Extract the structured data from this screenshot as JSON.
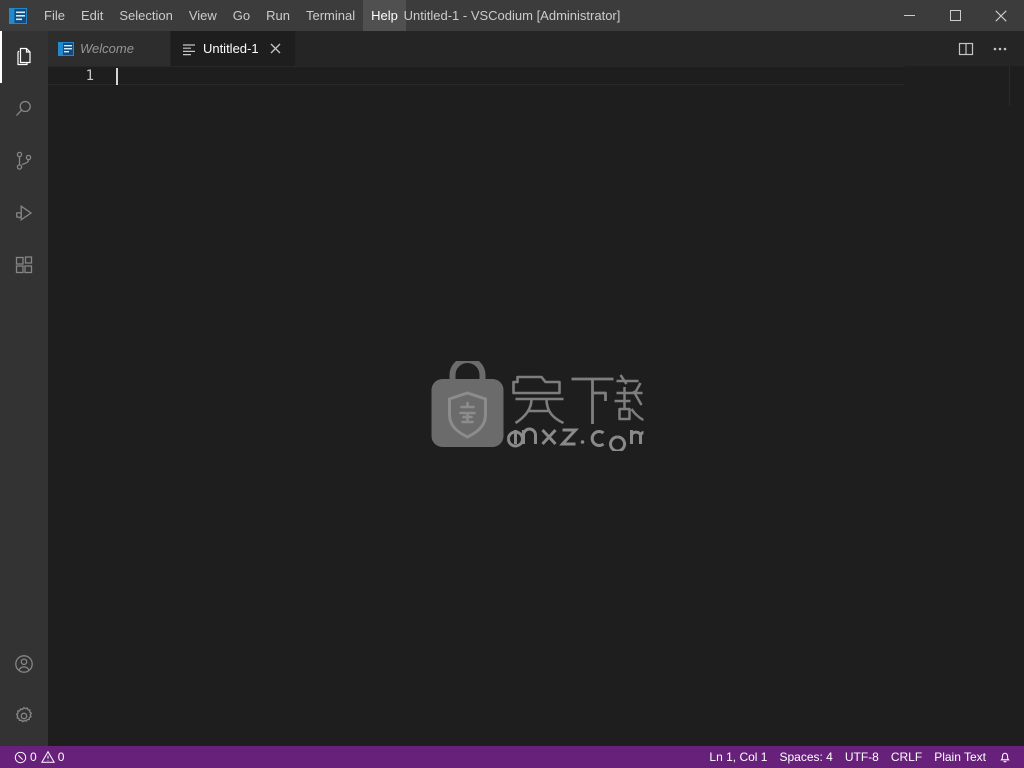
{
  "window": {
    "title": "Untitled-1 - VSCodium [Administrator]",
    "logo_icon": "vscodium-logo-icon",
    "controls": {
      "minimize": {
        "name": "minimize-button",
        "icon": "minimize-icon",
        "label": "Minimize"
      },
      "maximize": {
        "name": "maximize-button",
        "icon": "maximize-icon",
        "label": "Maximize"
      },
      "close": {
        "name": "close-button",
        "icon": "close-icon",
        "label": "Close"
      }
    }
  },
  "menubar": {
    "items": [
      {
        "label": "File",
        "active": false
      },
      {
        "label": "Edit",
        "active": false
      },
      {
        "label": "Selection",
        "active": false
      },
      {
        "label": "View",
        "active": false
      },
      {
        "label": "Go",
        "active": false
      },
      {
        "label": "Run",
        "active": false
      },
      {
        "label": "Terminal",
        "active": false
      },
      {
        "label": "Help",
        "active": true
      }
    ]
  },
  "activitybar": {
    "top_items": [
      {
        "label": "Explorer",
        "icon": "files-icon",
        "selected": true
      },
      {
        "label": "Search",
        "icon": "search-icon",
        "selected": false
      },
      {
        "label": "Source Control",
        "icon": "source-control-icon",
        "selected": false
      },
      {
        "label": "Run and Debug",
        "icon": "run-and-debug-icon",
        "selected": false
      },
      {
        "label": "Extensions",
        "icon": "extensions-icon",
        "selected": false
      }
    ],
    "bottom_items": [
      {
        "label": "Accounts",
        "icon": "account-icon",
        "selected": false
      },
      {
        "label": "Manage",
        "icon": "gear-icon",
        "selected": false
      }
    ]
  },
  "tabs": {
    "items": [
      {
        "label": "Welcome",
        "icon": "welcome-icon",
        "active": false,
        "preview": true,
        "closable": false
      },
      {
        "label": "Untitled-1",
        "icon": "plaintext-file-icon",
        "active": true,
        "preview": false,
        "closable": true
      }
    ],
    "close_icon": "close-icon",
    "actions": [
      {
        "label": "Split Editor Right",
        "icon": "split-editor-icon"
      },
      {
        "label": "More Actions...",
        "icon": "ellipsis-icon"
      }
    ]
  },
  "editor": {
    "line_number": "1",
    "content": "",
    "watermark": {
      "logo_icon": "anxz-bag-shield-logo-icon",
      "text_cn": "安下载",
      "text_domain": "anxz.com"
    }
  },
  "statusbar": {
    "left": [
      {
        "name": "problems",
        "error_icon": "error-circle-icon",
        "errors": "0",
        "warning_icon": "warning-triangle-icon",
        "warnings": "0"
      }
    ],
    "right": [
      {
        "name": "editor-selection",
        "label": "Ln 1, Col 1"
      },
      {
        "name": "editor-indentation",
        "label": "Spaces: 4"
      },
      {
        "name": "editor-encoding",
        "label": "UTF-8"
      },
      {
        "name": "editor-eol",
        "label": "CRLF"
      },
      {
        "name": "editor-language",
        "label": "Plain Text"
      },
      {
        "name": "notifications",
        "icon": "bell-icon",
        "label": ""
      }
    ]
  },
  "colors": {
    "titlebar_bg": "#3c3c3c",
    "activitybar_bg": "#333333",
    "tabbar_bg": "#252526",
    "tab_inactive_bg": "#2d2d2d",
    "editor_bg": "#1e1e1e",
    "statusbar_bg": "#68217a",
    "accent_blue": "#2489ca",
    "text_primary": "#cccccc"
  }
}
